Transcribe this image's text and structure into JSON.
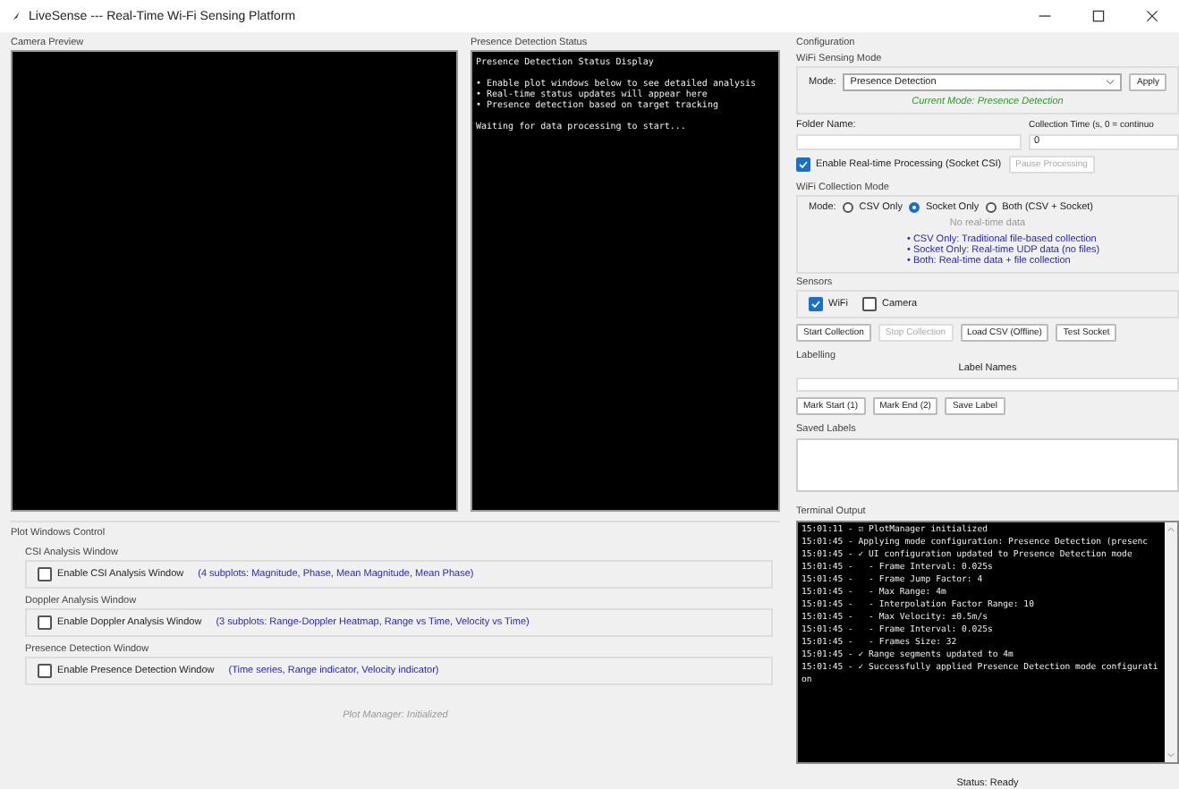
{
  "window": {
    "title": "LiveSense --- Real-Time Wi-Fi Sensing Platform"
  },
  "camera_preview": {
    "title": "Camera Preview"
  },
  "presence_status": {
    "title": "Presence Detection Status",
    "heading": "Presence Detection Status Display",
    "bullets": [
      "• Enable plot windows below to see detailed analysis",
      "• Real-time status updates will appear here",
      "• Presence detection based on target tracking"
    ],
    "message": "Waiting for data processing to start..."
  },
  "plot_windows_control": {
    "title": "Plot Windows Control",
    "groups": [
      {
        "title": "CSI Analysis Window",
        "checkbox_label": "Enable CSI Analysis Window",
        "checked": false,
        "description": "(4 subplots: Magnitude, Phase, Mean Magnitude, Mean Phase)"
      },
      {
        "title": "Doppler Analysis Window",
        "checkbox_label": "Enable Doppler Analysis Window",
        "checked": false,
        "description": "(3 subplots: Range-Doppler Heatmap, Range vs Time, Velocity vs Time)"
      },
      {
        "title": "Presence Detection Window",
        "checkbox_label": "Enable Presence Detection Window",
        "checked": false,
        "description": "(Time series, Range indicator, Velocity indicator)"
      }
    ],
    "status": "Plot Manager: Initialized"
  },
  "configuration": {
    "title": "Configuration",
    "sensing_mode": {
      "title": "WiFi Sensing Mode",
      "label": "Mode:",
      "value": "Presence Detection",
      "apply": "Apply",
      "current": "Current Mode: Presence Detection"
    },
    "folder_name": {
      "label": "Folder Name:"
    },
    "collection_time": {
      "label": "Collection Time (s, 0 = continuo",
      "value": "0"
    },
    "realtime": {
      "label": "Enable Real-time Processing (Socket CSI)",
      "checked": true,
      "pause": "Pause Processing",
      "pause_disabled": true
    },
    "collection_mode": {
      "title": "WiFi Collection Mode",
      "label": "Mode:",
      "options": [
        {
          "label": "CSV Only",
          "selected": false
        },
        {
          "label": "Socket Only",
          "selected": true
        },
        {
          "label": "Both (CSV + Socket)",
          "selected": false
        }
      ],
      "status": "No real-time data",
      "notes": [
        "• CSV Only: Traditional file-based collection",
        "• Socket Only: Real-time UDP data (no files)",
        "• Both: Real-time data + file collection"
      ]
    },
    "sensors": {
      "title": "Sensors",
      "items": [
        {
          "label": "WiFi",
          "checked": true
        },
        {
          "label": "Camera",
          "checked": false
        }
      ]
    },
    "actions": [
      {
        "label": "Start Collection",
        "disabled": false
      },
      {
        "label": "Stop Collection",
        "disabled": true
      },
      {
        "label": "Load CSV (Offline)",
        "disabled": false
      },
      {
        "label": "Test Socket",
        "disabled": false
      }
    ],
    "labelling": {
      "title": "Labelling",
      "label_name": "Label Names",
      "buttons": [
        "Mark Start (1)",
        "Mark End (2)",
        "Save Label"
      ]
    },
    "saved_labels": {
      "title": "Saved Labels"
    }
  },
  "terminal": {
    "title": "Terminal Output",
    "lines": [
      "15:01:11 - ☑ PlotManager initialized",
      "15:01:45 - Applying mode configuration: Presence Detection (presenc",
      "15:01:45 - ✓ UI configuration updated to Presence Detection mode",
      "15:01:45 -   - Frame Interval: 0.025s",
      "15:01:45 -   - Frame Jump Factor: 4",
      "15:01:45 -   - Max Range: 4m",
      "15:01:45 -   - Interpolation Factor Range: 10",
      "15:01:45 -   - Max Velocity: ±0.5m/s",
      "15:01:45 -   - Frame Interval: 0.025s",
      "15:01:45 -   - Frames Size: 32",
      "15:01:45 - ✓ Range segments updated to 4m",
      "15:01:45 - ✓ Successfully applied Presence Detection mode configuration"
    ]
  },
  "status_bar": "Status: Ready"
}
